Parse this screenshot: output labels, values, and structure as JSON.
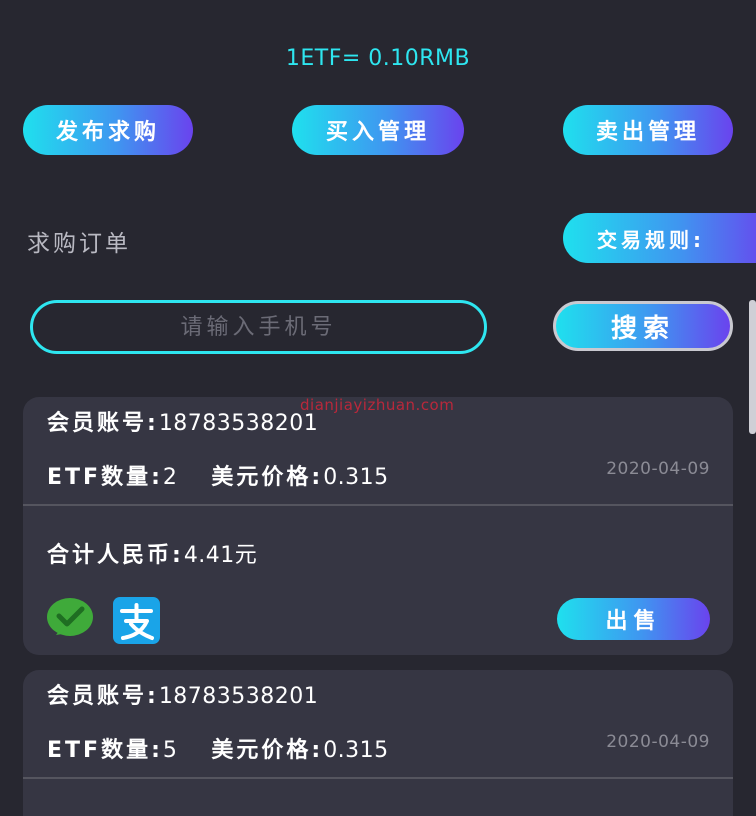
{
  "rate_text": "1ETF= 0.10RMB",
  "actions": {
    "publish_label": "发布求购",
    "buy_manage_label": "买入管理",
    "sell_manage_label": "卖出管理"
  },
  "section": {
    "title": "求购订单",
    "rules_label": "交易规则:"
  },
  "search": {
    "placeholder": "请输入手机号",
    "value": "",
    "button_label": "搜索"
  },
  "watermark": "dianjiayizhuan.com",
  "labels": {
    "account": "会员账号:",
    "etf_qty": "ETF数量:",
    "usd_price": "美元价格:",
    "total_rmb": "合计人民币:",
    "sell_button": "出售"
  },
  "orders": [
    {
      "account": "18783538201",
      "etf_qty": "2",
      "usd_price": "0.315",
      "date": "2020-04-09",
      "total": "4.41元",
      "payment_icons": [
        "wechat-pay-icon",
        "alipay-icon"
      ]
    },
    {
      "account": "18783538201",
      "etf_qty": "5",
      "usd_price": "0.315",
      "date": "2020-04-09"
    }
  ],
  "colors": {
    "background": "#272730",
    "card": "#363643",
    "accent_cyan": "#2ee6f0",
    "gradient_start": "#1fe0ee",
    "gradient_end": "#6a43ee",
    "wechat_green": "#3faa3a",
    "alipay_blue": "#1aa4e8"
  }
}
